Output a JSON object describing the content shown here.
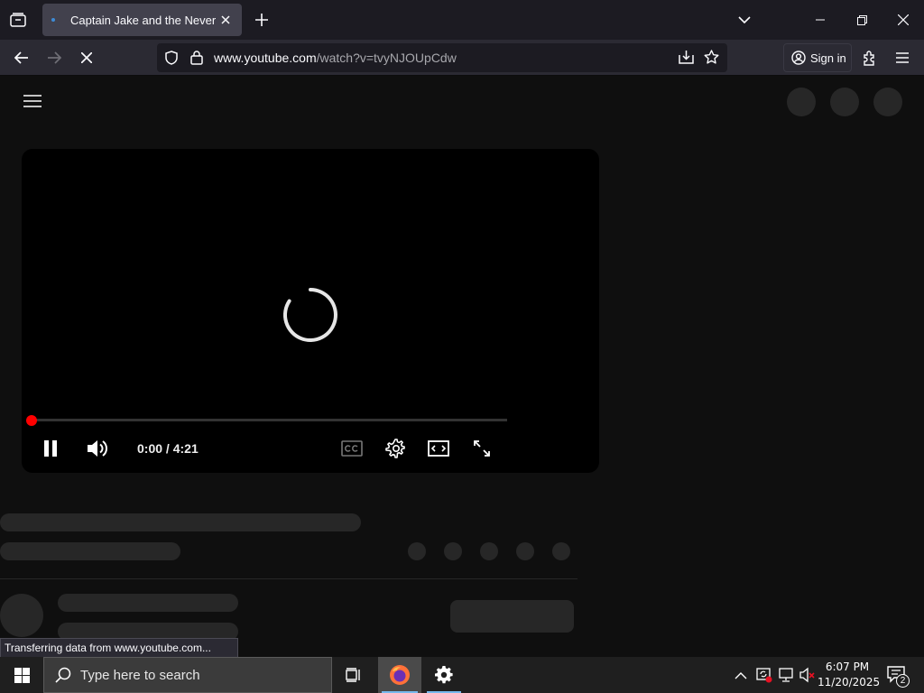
{
  "browser": {
    "tab": {
      "title": "Captain Jake and the Never Land Pirates"
    },
    "url": {
      "host": "www.youtube.com",
      "path": "/watch?v=tvyNJOUpCdw"
    },
    "sign_in_label": "Sign in"
  },
  "player": {
    "time_current": "0:00",
    "time_separator": "/",
    "time_total": "4:21",
    "progress_fraction": 0.0,
    "state": "buffering"
  },
  "status_bar": {
    "text": "Transferring data from www.youtube.com..."
  },
  "taskbar": {
    "search_placeholder": "Type here to search",
    "clock_time": "6:07 PM",
    "clock_date": "11/20/2025",
    "notification_count": "2"
  },
  "icons": {
    "tab_list": "tab-list-icon",
    "close": "close-icon",
    "new_tab": "plus-icon",
    "back": "back-arrow-icon",
    "forward": "forward-arrow-icon",
    "stop": "stop-icon",
    "shield": "tracking-protection-icon",
    "lock": "lock-icon",
    "download": "download-icon",
    "bookmark": "star-icon",
    "account": "account-icon",
    "extensions": "extensions-icon",
    "menu": "hamburger-icon",
    "play_pause": "pause-icon",
    "volume": "volume-icon",
    "captions": "captions-icon",
    "settings": "gear-icon",
    "theater": "theater-mode-icon",
    "fullscreen": "fullscreen-icon"
  },
  "colors": {
    "accent_red": "#ff0000",
    "tab_dot": "#3d8bd6",
    "taskbar_indicator": "#76b9ed"
  }
}
